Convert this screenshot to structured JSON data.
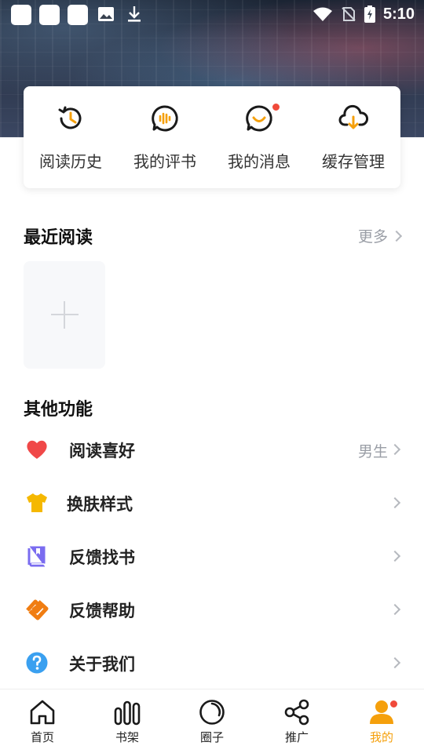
{
  "status_bar": {
    "time": "5:10"
  },
  "quick_actions": [
    {
      "label": "阅读历史",
      "icon": "history-icon"
    },
    {
      "label": "我的评书",
      "icon": "audio-comment-icon"
    },
    {
      "label": "我的消息",
      "icon": "message-icon",
      "badge": true
    },
    {
      "label": "缓存管理",
      "icon": "cloud-download-icon"
    }
  ],
  "recent": {
    "title": "最近阅读",
    "more_label": "更多"
  },
  "other": {
    "title": "其他功能",
    "items": [
      {
        "label": "阅读喜好",
        "value": "男生",
        "icon": "heart-icon",
        "color": "#f04848"
      },
      {
        "label": "换肤样式",
        "value": "",
        "icon": "tshirt-icon",
        "color": "#f5b800"
      },
      {
        "label": "反馈找书",
        "value": "",
        "icon": "book-icon",
        "color": "#7a6cf0"
      },
      {
        "label": "反馈帮助",
        "value": "",
        "icon": "help-hand-icon",
        "color": "#f07d12"
      },
      {
        "label": "关于我们",
        "value": "",
        "icon": "question-icon",
        "color": "#3aa0f0"
      }
    ]
  },
  "bottom_nav": [
    {
      "label": "首页",
      "icon": "home-icon",
      "active": false
    },
    {
      "label": "书架",
      "icon": "bookshelf-icon",
      "active": false
    },
    {
      "label": "圈子",
      "icon": "circle-icon",
      "active": false
    },
    {
      "label": "推广",
      "icon": "share-icon",
      "active": false
    },
    {
      "label": "我的",
      "icon": "user-icon",
      "active": true
    }
  ],
  "colors": {
    "accent": "#f5a00c",
    "badge": "#f04a3a",
    "muted": "#9a9ea6"
  }
}
